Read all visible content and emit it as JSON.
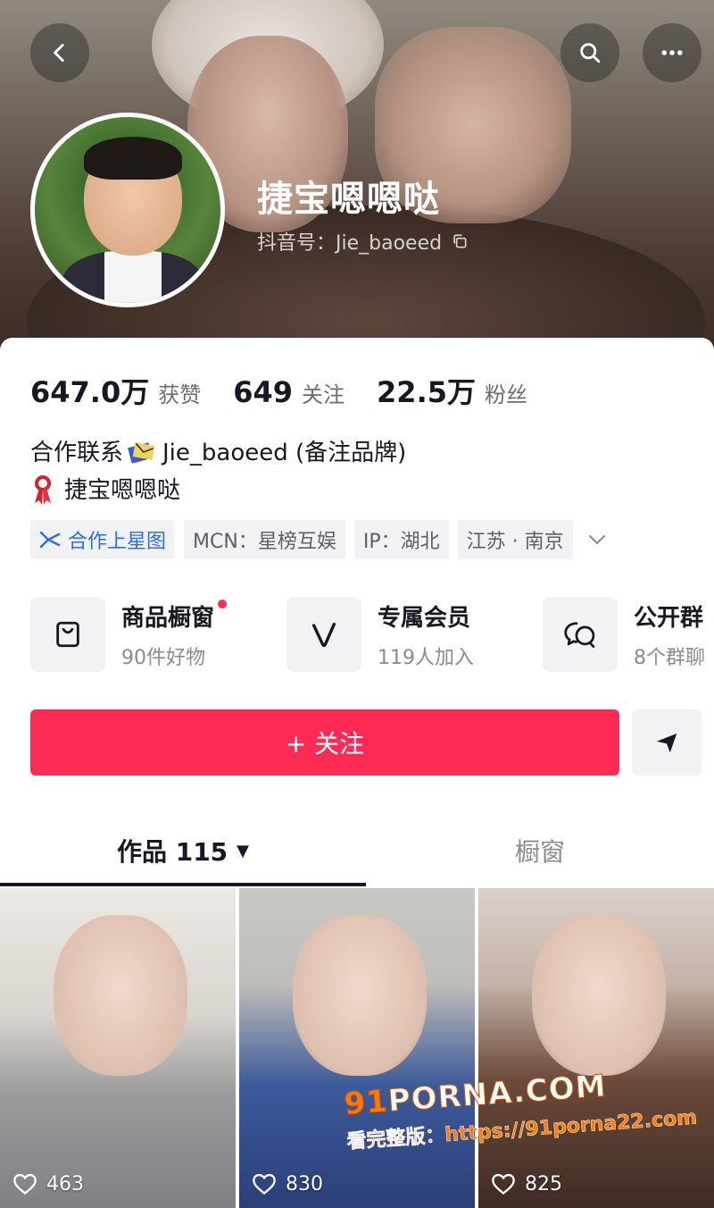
{
  "header": {
    "name": "捷宝嗯嗯哒",
    "douyin_id": "抖音号：Jie_baoeed"
  },
  "stats": [
    {
      "value": "647.0万",
      "label": "获赞"
    },
    {
      "value": "649",
      "label": "关注"
    },
    {
      "value": "22.5万",
      "label": "粉丝"
    }
  ],
  "bio": {
    "line1_prefix": "合作联系",
    "line1_suffix": "Jie_baoeed (备注品牌)",
    "line2": "捷宝嗯嗯哒"
  },
  "tags": {
    "star": "合作上星图",
    "mcn": "MCN：星榜互娱",
    "ip": "IP：湖北",
    "location": "江苏 · 南京"
  },
  "services": [
    {
      "title": "商品橱窗",
      "sub": "90件好物"
    },
    {
      "title": "专属会员",
      "sub": "119人加入"
    },
    {
      "title": "公开群",
      "sub": "8个群聊"
    }
  ],
  "follow_button": "+ 关注",
  "tabs": {
    "works": "作品 115",
    "works_caret": "▼",
    "showcase": "橱窗"
  },
  "videos": [
    {
      "likes": "463"
    },
    {
      "likes": "830"
    },
    {
      "likes": "825"
    }
  ],
  "watermark": {
    "logo_num": "91",
    "logo_text": "PORNA.COM",
    "url": "看完整版：https://91porna22.com"
  },
  "colors": {
    "accent": "#fe2c55",
    "star_blue": "#2a6fe5"
  }
}
